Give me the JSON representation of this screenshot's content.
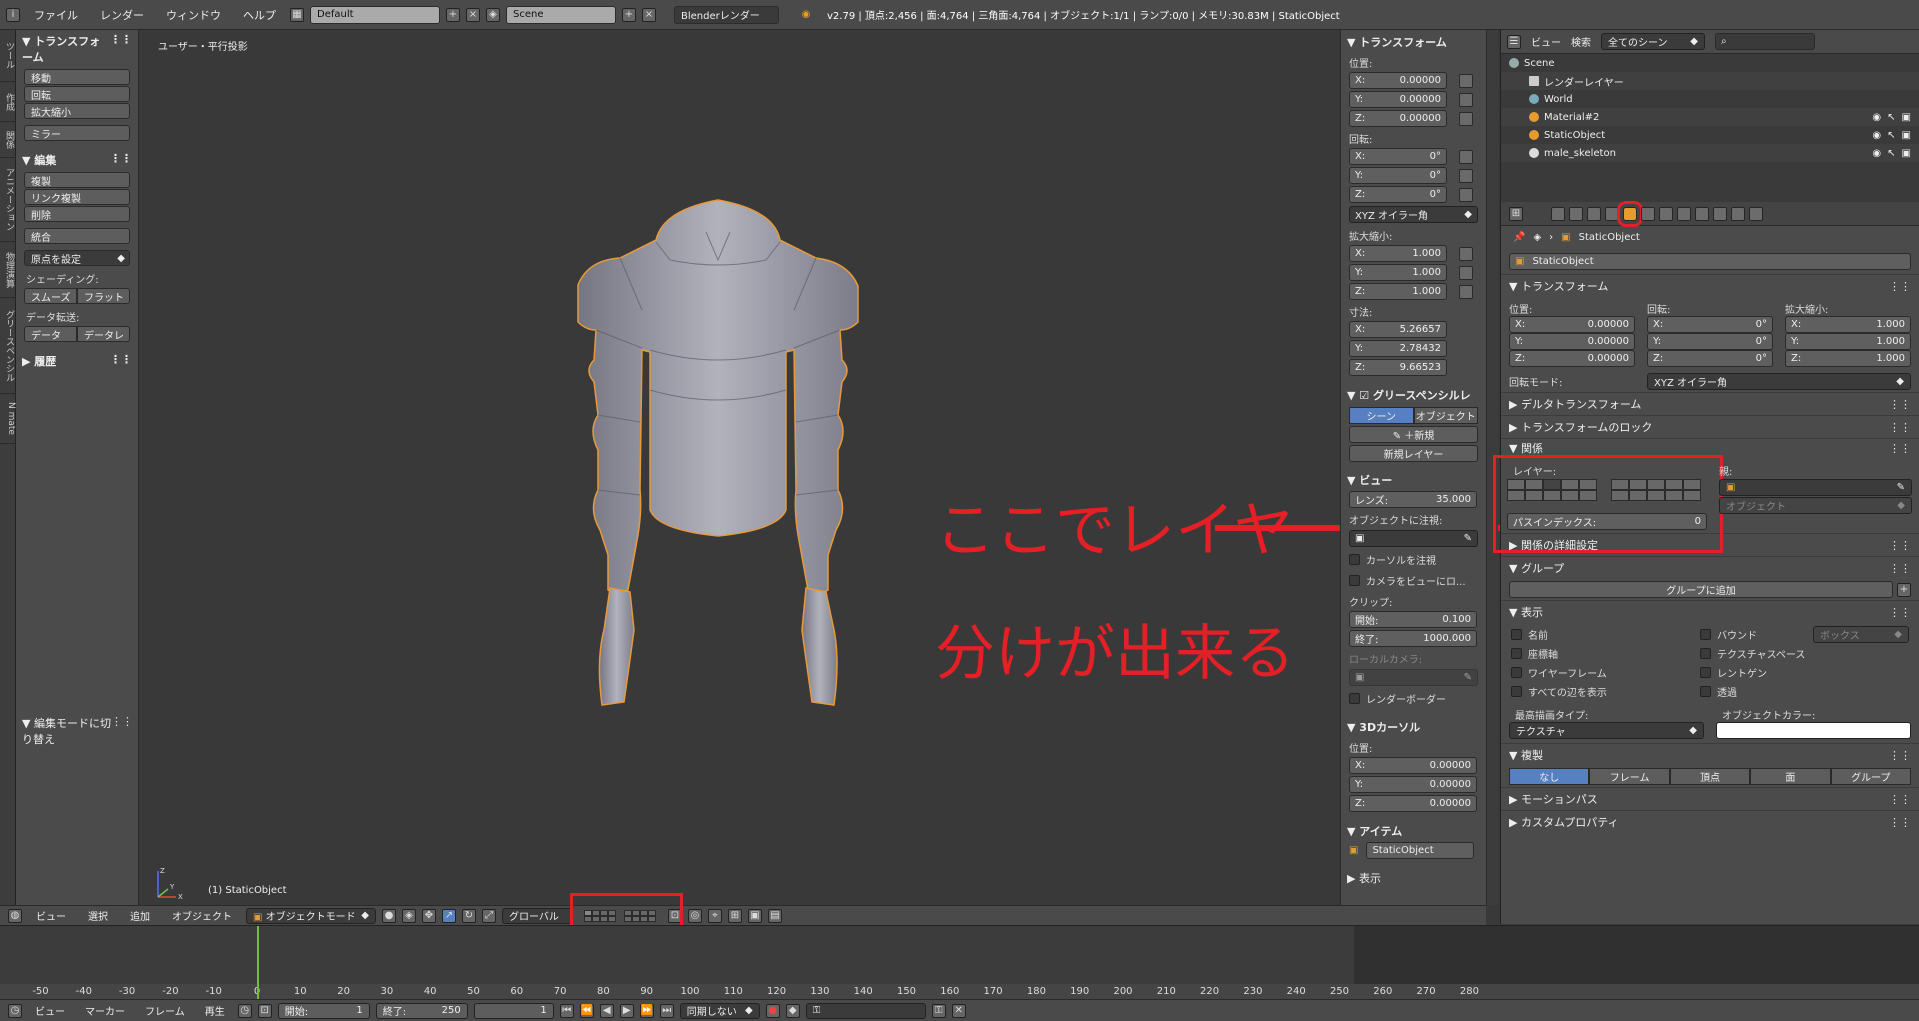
{
  "topbar": {
    "menus": [
      "ファイル",
      "レンダー",
      "ウィンドウ",
      "ヘルプ"
    ],
    "screen_layout": "Default",
    "scene": "Scene",
    "render_engine": "Blenderレンダー",
    "stats": "v2.79 | 頂点:2,456 | 面:4,764 | 三角面:4,764 | オブジェクト:1/1 | ランプ:0/0 | メモリ:30.83M | StaticObject"
  },
  "left_tabs": [
    "ツール",
    "作成",
    "関係",
    "アニメーション",
    "物理演算",
    "グリースペンシル",
    "N mate"
  ],
  "toolshelf": {
    "transform_title": "トランスフォーム",
    "transform_buttons": [
      "移動",
      "回転",
      "拡大縮小"
    ],
    "mirror": "ミラー",
    "edit_title": "編集",
    "edit_buttons": [
      "複製",
      "リンク複製",
      "削除"
    ],
    "join": "統合",
    "set_origin": "原点を設定",
    "shading_label": "シェーディング:",
    "shading_smooth": "スムーズ",
    "shading_flat": "フラット",
    "data_transfer_label": "データ転送:",
    "data_btn": "データ",
    "data_layout_btn": "データレ",
    "history": "履歴",
    "operator": "編集モードに切り替え"
  },
  "viewport": {
    "title": "ユーザー・平行投影",
    "object_label": "(1) StaticObject",
    "axis_z": "Z",
    "axis_y": "Y",
    "axis_x": "X"
  },
  "npanel": {
    "transform": "トランスフォーム",
    "location_label": "位置:",
    "location": [
      "X:",
      "0.00000",
      "Y:",
      "0.00000",
      "Z:",
      "0.00000"
    ],
    "rotation_label": "回転:",
    "rotation": [
      "X:",
      "0°",
      "Y:",
      "0°",
      "Z:",
      "0°"
    ],
    "rotation_mode": "XYZ オイラー角",
    "scale_label": "拡大縮小:",
    "scale": [
      "X:",
      "1.000",
      "Y:",
      "1.000",
      "Z:",
      "1.000"
    ],
    "dimensions_label": "寸法:",
    "dimensions": [
      "X:",
      "5.26657",
      "Y:",
      "2.78432",
      "Z:",
      "9.66523"
    ],
    "grease_pencil": "グリースペンシルレ",
    "gp_scene": "シーン",
    "gp_object": "オブジェクト",
    "gp_new": "新規",
    "gp_new_layer": "新規レイヤー",
    "view": "ビュー",
    "lens_label": "レンズ:",
    "lens_value": "35.000",
    "lock_object_label": "オブジェクトに注視:",
    "lock_cursor": "カーソルを注視",
    "lock_camera": "カメラをビューにロ...",
    "clip_label": "クリップ:",
    "clip_start_label": "開始:",
    "clip_start": "0.100",
    "clip_end_label": "終了:",
    "clip_end": "1000.000",
    "local_camera": "ローカルカメラ:",
    "render_border": "レンダーボーダー",
    "cursor_title": "3Dカーソル",
    "cursor_location_label": "位置:",
    "cursor": [
      "X:",
      "0.00000",
      "Y:",
      "0.00000",
      "Z:",
      "0.00000"
    ],
    "item_title": "アイテム",
    "item_name": "StaticObject",
    "display_title": "表示"
  },
  "outliner": {
    "menu_view": "ビュー",
    "menu_search": "検索",
    "filter": "全てのシーン",
    "rows": [
      {
        "label": "Scene",
        "indent": 0
      },
      {
        "label": "レンダーレイヤー",
        "indent": 1
      },
      {
        "label": "World",
        "indent": 1
      },
      {
        "label": "Material#2",
        "indent": 1
      },
      {
        "label": "StaticObject",
        "indent": 1
      },
      {
        "label": "male_skeleton",
        "indent": 1
      }
    ]
  },
  "properties": {
    "breadcrumb": "StaticObject",
    "object_name": "StaticObject",
    "transform_title": "トランスフォーム",
    "loc_label": "位置:",
    "rot_label": "回転:",
    "scale_label": "拡大縮小:",
    "loc": [
      "X:",
      "0.00000",
      "Y:",
      "0.00000",
      "Z:",
      "0.00000"
    ],
    "rot": [
      "X:",
      "0°",
      "Y:",
      "0°",
      "Z:",
      "0°"
    ],
    "scl": [
      "X:",
      "1.000",
      "Y:",
      "1.000",
      "Z:",
      "1.000"
    ],
    "rotation_mode_label": "回転モード:",
    "rotation_mode": "XYZ オイラー角",
    "delta": "デルタトランスフォーム",
    "transform_lock": "トランスフォームのロック",
    "relations": "関係",
    "layers_label": "レイヤー:",
    "parent_label": "親:",
    "parent_type": "オブジェクト",
    "pass_index_label": "パスインデックス:",
    "pass_index": "0",
    "relations_extras": "関係の詳細設定",
    "groups": "グループ",
    "add_to_group": "グループに追加",
    "display": "表示",
    "name_cb": "名前",
    "axis_cb": "座標軸",
    "wire_cb": "ワイヤーフレーム",
    "alledges_cb": "すべての辺を表示",
    "bounds_cb": "バウンド",
    "bounds_type": "ボックス",
    "texspace_cb": "テクスチャスペース",
    "xray_cb": "レントゲン",
    "transp_cb": "透過",
    "max_draw_label": "最高描画タイプ:",
    "max_draw": "テクスチャ",
    "obj_color_label": "オブジェクトカラー:",
    "duplication": "複製",
    "dup_options": [
      "なし",
      "フレーム",
      "頂点",
      "面",
      "グループ"
    ],
    "motion_paths": "モーションパス",
    "custom_props": "カスタムプロパティ"
  },
  "header3d": {
    "menus": [
      "ビュー",
      "選択",
      "追加",
      "オブジェクト"
    ],
    "mode": "オブジェクトモード",
    "orientation": "グローバル"
  },
  "timeline": {
    "ticks": [
      "-50",
      "-40",
      "-30",
      "-20",
      "-10",
      "0",
      "10",
      "20",
      "30",
      "40",
      "50",
      "60",
      "70",
      "80",
      "90",
      "100",
      "110",
      "120",
      "130",
      "140",
      "150",
      "160",
      "170",
      "180",
      "190",
      "200",
      "210",
      "220",
      "230",
      "240",
      "250",
      "260",
      "270",
      "280"
    ],
    "current_frame_value": 0
  },
  "footer": {
    "menus": [
      "ビュー",
      "マーカー",
      "フレーム",
      "再生"
    ],
    "start_label": "開始:",
    "start": "1",
    "end_label": "終了:",
    "end": "250",
    "current": "1",
    "sync": "同期しない"
  },
  "annotation": {
    "line1": "ここでレイヤー",
    "line2": "分けが出来る",
    "color": "#e41f26"
  }
}
